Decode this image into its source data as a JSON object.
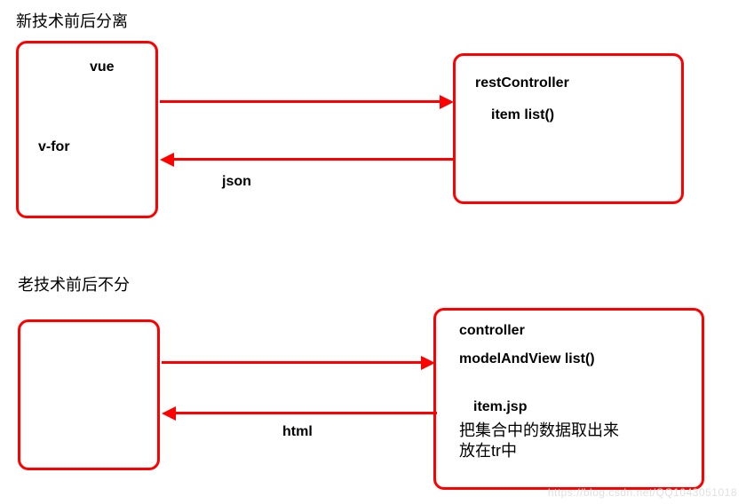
{
  "section1": {
    "title": "新技术前后分离",
    "leftBox": {
      "line1": "vue",
      "line2": "v-for"
    },
    "rightBox": {
      "line1": "restController",
      "line2": "item list()"
    },
    "arrowBottomLabel": "json"
  },
  "section2": {
    "title": "老技术前后不分",
    "rightBox": {
      "line1": "controller",
      "line2": "modelAndView list()",
      "line3": "item.jsp",
      "line4": "把集合中的数据取出来\n放在tr中"
    },
    "arrowBottomLabel": "html"
  },
  "watermark": "https://blog.csdn.net/QQ1043051018"
}
